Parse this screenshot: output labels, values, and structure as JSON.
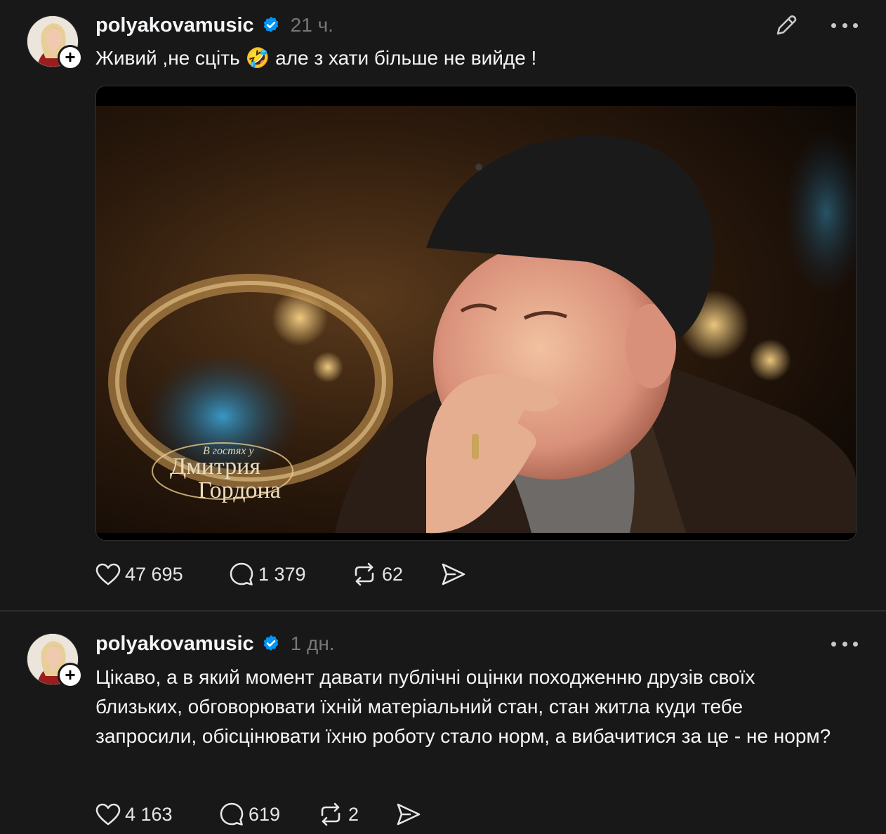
{
  "posts": [
    {
      "username": "polyakovamusic",
      "timestamp": "21 ч.",
      "text": "Живий ,не сціть 🤣 але з хати більше не вийде !",
      "media": {
        "overlay_line1": "В гостях у",
        "overlay_line2": "Дмитрия",
        "overlay_line3": "Гордона"
      },
      "likes": "47 695",
      "replies": "1 379",
      "reposts": "62"
    },
    {
      "username": "polyakovamusic",
      "timestamp": "1 дн.",
      "text": "Цікаво, а в який момент давати публічні оцінки походженню друзів своїх близьких, обговорювати їхній матеріальний стан, стан житла куди тебе запросили, обісцінювати їхню роботу стало норм, а вибачитися за це - не норм?",
      "likes": "4 163",
      "replies": "619",
      "reposts": "2"
    }
  ],
  "icons": {
    "verified": "verified-badge-icon",
    "edit": "pencil-icon",
    "more": "more-dots-icon",
    "like": "heart-icon",
    "reply": "comment-icon",
    "repost": "repost-icon",
    "share": "send-icon",
    "follow": "plus-icon"
  },
  "colors": {
    "background": "#181818",
    "text": "#f3f5f7",
    "muted": "#777777",
    "verified": "#0095f6"
  }
}
